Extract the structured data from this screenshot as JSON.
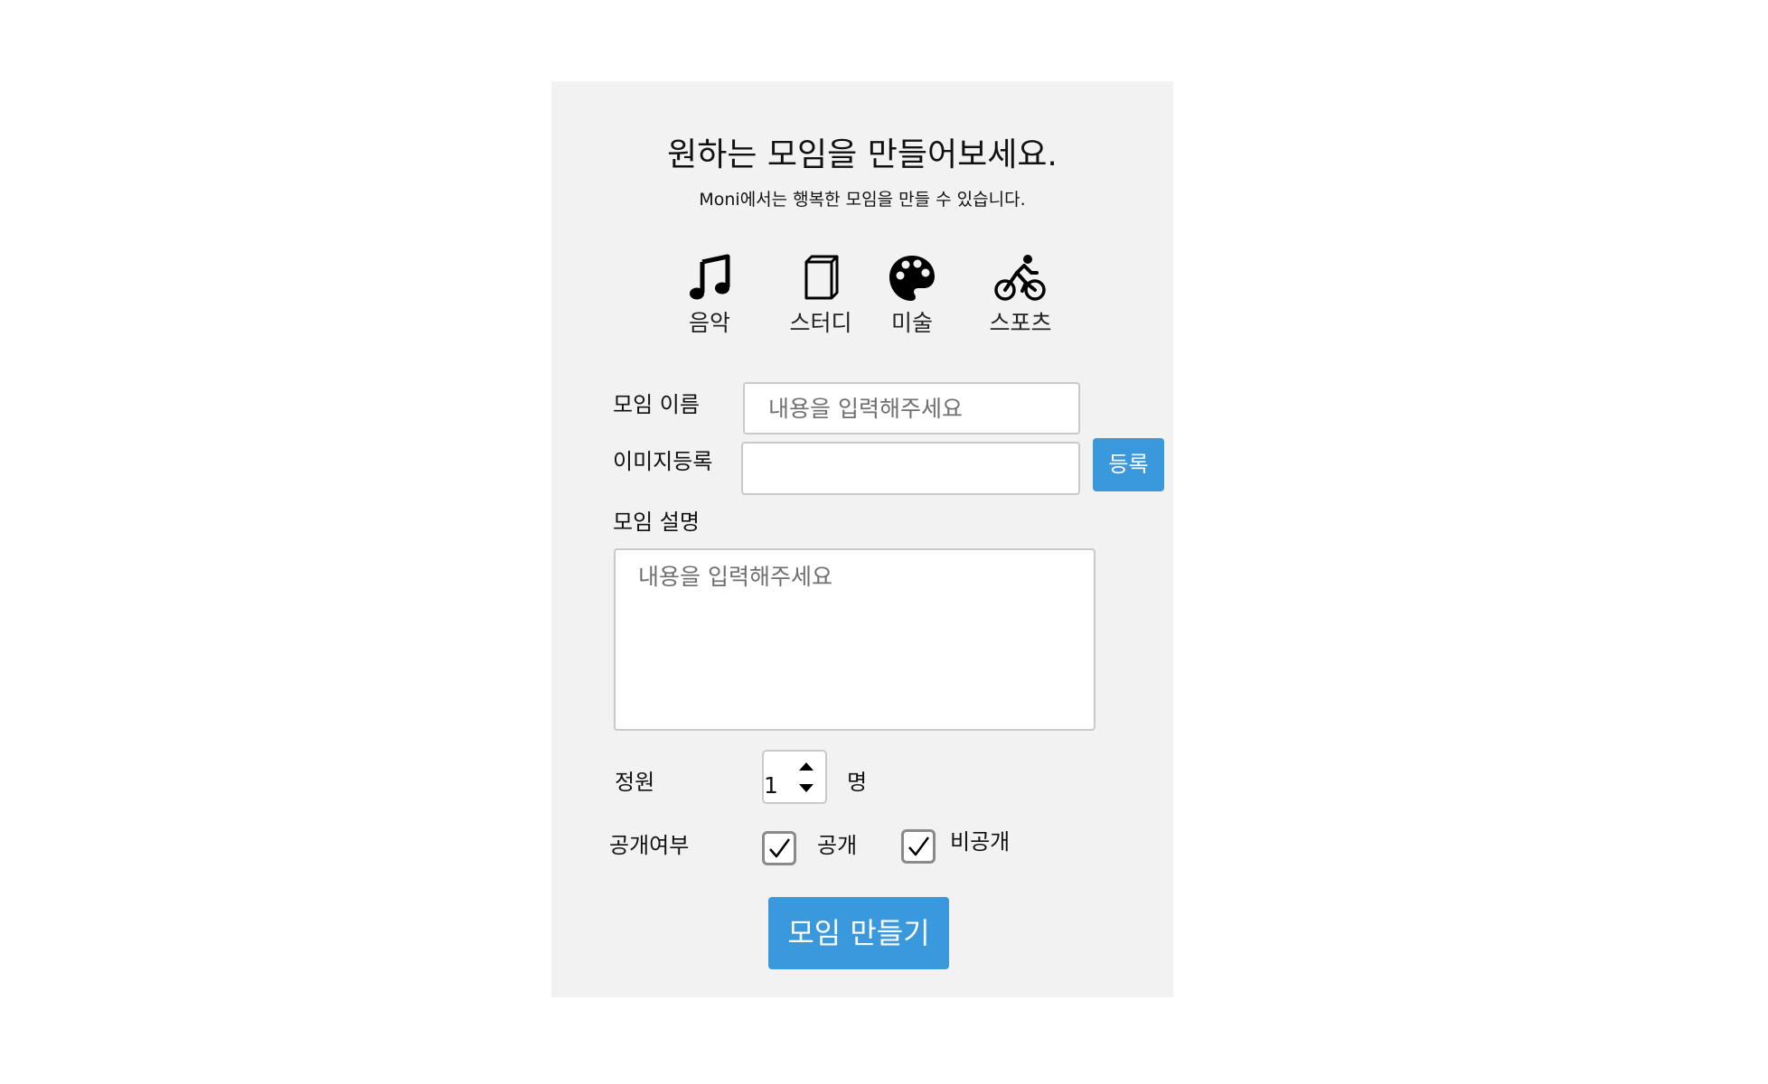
{
  "header": {
    "title": "원하는 모임을 만들어보세요.",
    "subtitle": "Moni에서는 행복한 모임을 만들 수 있습니다."
  },
  "categories": [
    {
      "label": "음악",
      "icon": "music-note-icon"
    },
    {
      "label": "스터디",
      "icon": "book-icon"
    },
    {
      "label": "미술",
      "icon": "palette-icon"
    },
    {
      "label": "스포츠",
      "icon": "cyclist-icon"
    }
  ],
  "form": {
    "name_label": "모임 이름",
    "name_placeholder": "내용을 입력해주세요",
    "image_label": "이미지등록",
    "image_value": "",
    "register_button": "등록",
    "description_label": "모임 설명",
    "description_placeholder": "내용을 입력해주세요",
    "capacity_label": "정원",
    "capacity_value": "1",
    "capacity_unit": "명",
    "visibility_label": "공개여부",
    "public_label": "공개",
    "private_label": "비공개",
    "public_checked": true,
    "private_checked": true,
    "submit_button": "모임 만들기"
  },
  "colors": {
    "panel_bg": "#f2f2f2",
    "accent": "#3a98dc"
  }
}
